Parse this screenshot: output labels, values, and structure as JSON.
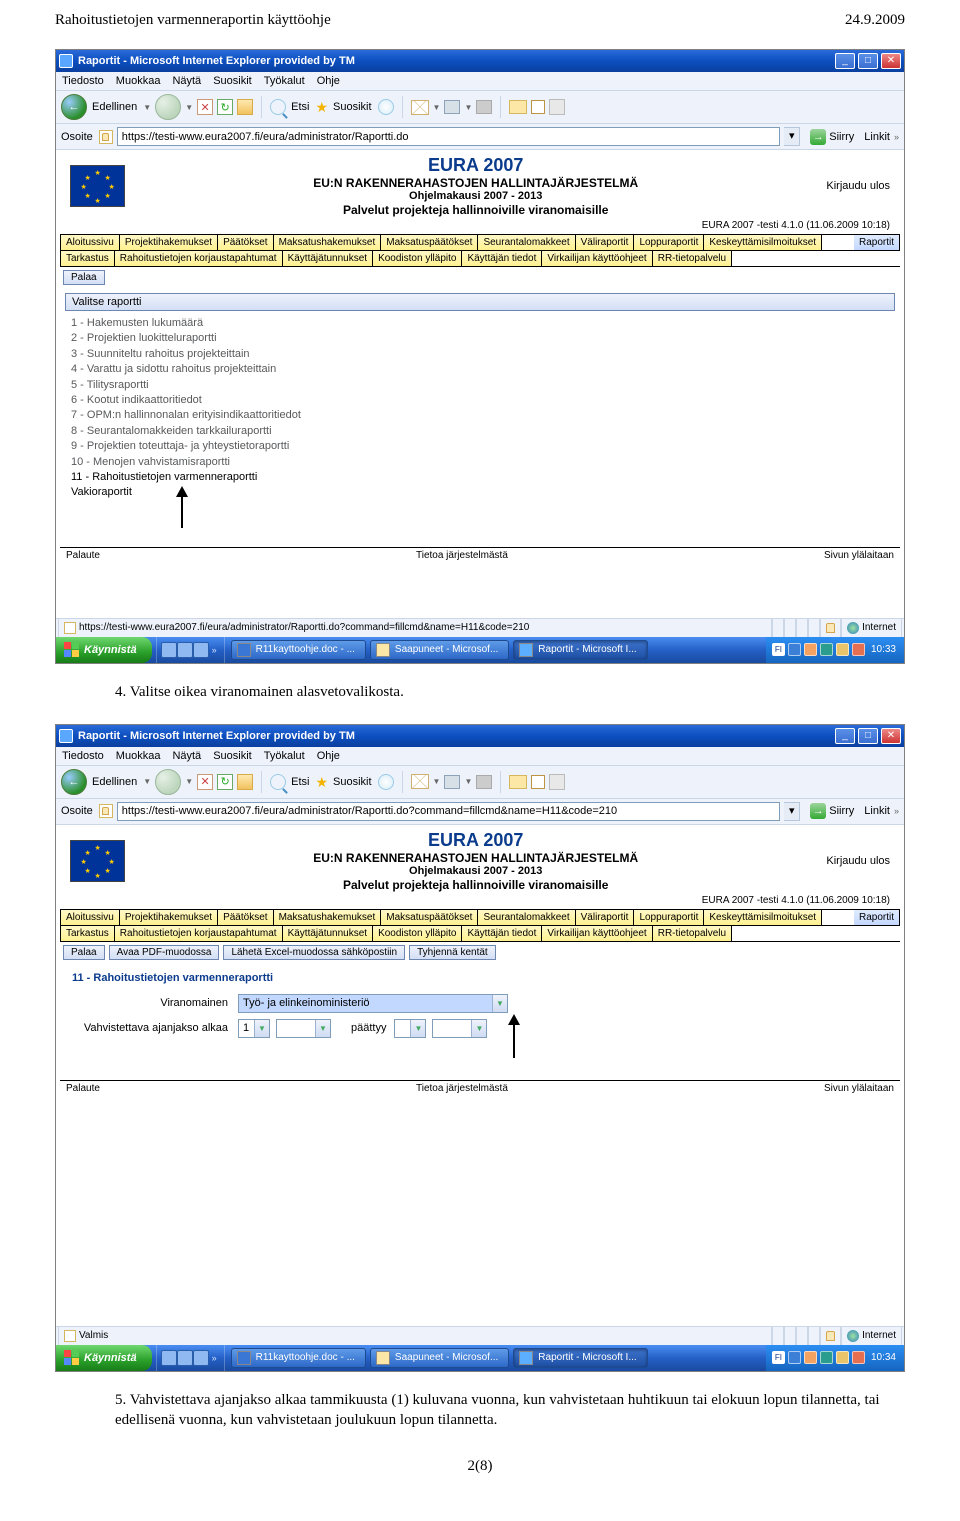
{
  "doc": {
    "header_left": "Rahoitustietojen varmenneraportin käyttöohje",
    "header_right": "24.9.2009",
    "para1_num": "4.",
    "para1": "Valitse oikea viranomainen alasvetovalikosta.",
    "para2_num": "5.",
    "para2": "Vahvistettava ajanjakso alkaa tammikuusta (1) kuluvana vuonna, kun vahvistetaan huhtikuun tai elokuun lopun tilannetta, tai edellisenä vuonna, kun vahvistetaan joulukuun lopun tilannetta.",
    "page_num": "2(8)"
  },
  "ie": {
    "title": "Raportit - Microsoft Internet Explorer provided by TM",
    "menu": [
      "Tiedosto",
      "Muokkaa",
      "Näytä",
      "Suosikit",
      "Työkalut",
      "Ohje"
    ],
    "tb_back": "Edellinen",
    "tb_search": "Etsi",
    "tb_fav": "Suosikit",
    "addr_label": "Osoite",
    "addr1": "https://testi-www.eura2007.fi/eura/administrator/Raportti.do",
    "addr2": "https://testi-www.eura2007.fi/eura/administrator/Raportti.do?command=fillcmd&name=H11&code=210",
    "go": "Siirry",
    "links": "Linkit",
    "status_done": "https://testi-www.eura2007.fi/eura/administrator/Raportti.do?command=fillcmd&name=H11&code=210",
    "status2": "Valmis",
    "internet": "Internet"
  },
  "eura": {
    "title": "EURA 2007",
    "subtitle": "EU:N RAKENNERAHASTOJEN HALLINTAJÄRJESTELMÄ",
    "period": "Ohjelmakausi 2007 - 2013",
    "services": "Palvelut projekteja hallinnoiville viranomaisille",
    "logout": "Kirjaudu ulos",
    "version": "EURA 2007 -testi 4.1.0 (11.06.2009 10:18)",
    "tabs1": [
      "Aloitussivu",
      "Projektihakemukset",
      "Päätökset",
      "Maksatushakemukset",
      "Maksatuspäätökset",
      "Seurantalomakkeet",
      "Väliraportit",
      "Loppuraportit",
      "Keskeyttämisilmoitukset",
      "Raportit"
    ],
    "tabs2": [
      "Tarkastus",
      "Rahoitustietojen korjaustapahtumat",
      "Käyttäjätunnukset",
      "Koodiston ylläpito",
      "Käyttäjän tiedot",
      "Virkailijan käyttöohjeet",
      "RR-tietopalvelu"
    ],
    "palaa": "Palaa",
    "sec_btns": [
      "Avaa PDF-muodossa",
      "Lähetä Excel-muodossa sähköpostiin",
      "Tyhjennä kentät"
    ],
    "list_heading": "Valitse raportti",
    "reports": [
      "1 - Hakemusten lukumäärä",
      "2 - Projektien luokitteluraportti",
      "3 - Suunniteltu rahoitus projekteittain",
      "4 - Varattu ja sidottu rahoitus projekteittain",
      "5 - Tilitysraportti",
      "6 - Kootut indikaattoritiedot",
      "7 - OPM:n hallinnonalan erityisindikaattoritiedot",
      "8 - Seurantalomakkeiden tarkkailuraportti",
      "9 - Projektien toteuttaja- ja yhteystietoraportti",
      "10 - Menojen vahvistamisraportti",
      "11 - Rahoitustietojen varmenneraportti"
    ],
    "vakio": "Vakioraportit",
    "footer_left": "Palaute",
    "footer_mid": "Tietoa järjestelmästä",
    "footer_right": "Sivun ylälaitaan",
    "form_title": "11 - Rahoitustietojen varmenneraportti",
    "lbl_viranom": "Viranomainen",
    "val_viranom": "Työ- ja elinkeinoministeriö",
    "lbl_alkaa": "Vahvistettava ajanjakso alkaa",
    "val_alkaa": "1",
    "lbl_paattyy": "päättyy"
  },
  "taskbar": {
    "start": "Käynnistä",
    "items1": [
      "R11kayttoohje.doc - ...",
      "Saapuneet - Microsof...",
      "Raportit - Microsoft I..."
    ],
    "time1": "10:33",
    "time2": "10:34",
    "fi": "FI"
  }
}
